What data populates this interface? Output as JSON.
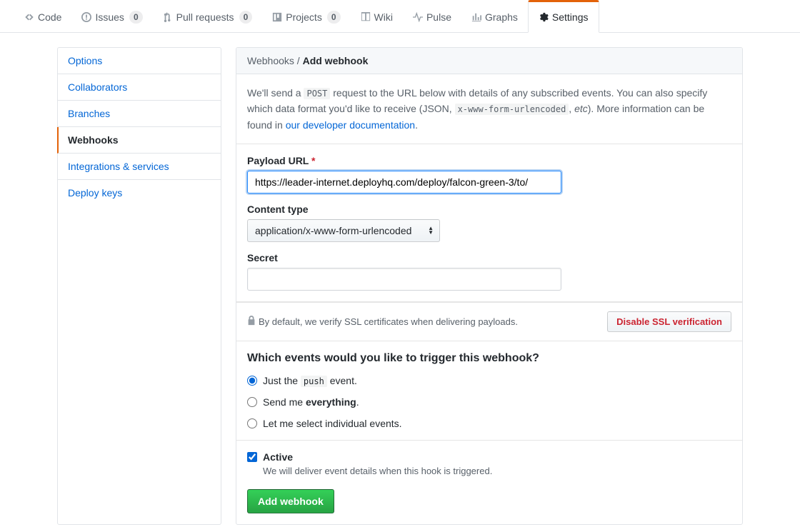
{
  "tabs": {
    "code": "Code",
    "issues": "Issues",
    "issues_count": "0",
    "pulls": "Pull requests",
    "pulls_count": "0",
    "projects": "Projects",
    "projects_count": "0",
    "wiki": "Wiki",
    "pulse": "Pulse",
    "graphs": "Graphs",
    "settings": "Settings"
  },
  "sidebar": {
    "options": "Options",
    "collaborators": "Collaborators",
    "branches": "Branches",
    "webhooks": "Webhooks",
    "integrations": "Integrations & services",
    "deploy_keys": "Deploy keys"
  },
  "breadcrumb": {
    "parent": "Webhooks",
    "sep": "/",
    "current": "Add webhook"
  },
  "desc": {
    "pre": "We'll send a ",
    "post_code": "POST",
    "mid1": " request to the URL below with details of any subscribed events. You can also specify which data format you'd like to receive (JSON, ",
    "form_code": "x-www-form-urlencoded",
    "mid2": ", ",
    "etc": "etc",
    "mid3": "). More information can be found in ",
    "doc_link": "our developer documentation",
    "period": "."
  },
  "form": {
    "payload_label": "Payload URL",
    "payload_value": "https://leader-internet.deployhq.com/deploy/falcon-green-3/to/",
    "content_type_label": "Content type",
    "content_type_value": "application/x-www-form-urlencoded",
    "secret_label": "Secret",
    "secret_value": ""
  },
  "ssl": {
    "note": "By default, we verify SSL certificates when delivering payloads.",
    "disable": "Disable SSL verification"
  },
  "events": {
    "title": "Which events would you like to trigger this webhook?",
    "opt1_pre": "Just the ",
    "opt1_code": "push",
    "opt1_post": " event.",
    "opt2_pre": "Send me ",
    "opt2_strong": "everything",
    "opt2_post": ".",
    "opt3": "Let me select individual events."
  },
  "active": {
    "label": "Active",
    "sub": "We will deliver event details when this hook is triggered."
  },
  "submit": "Add webhook"
}
